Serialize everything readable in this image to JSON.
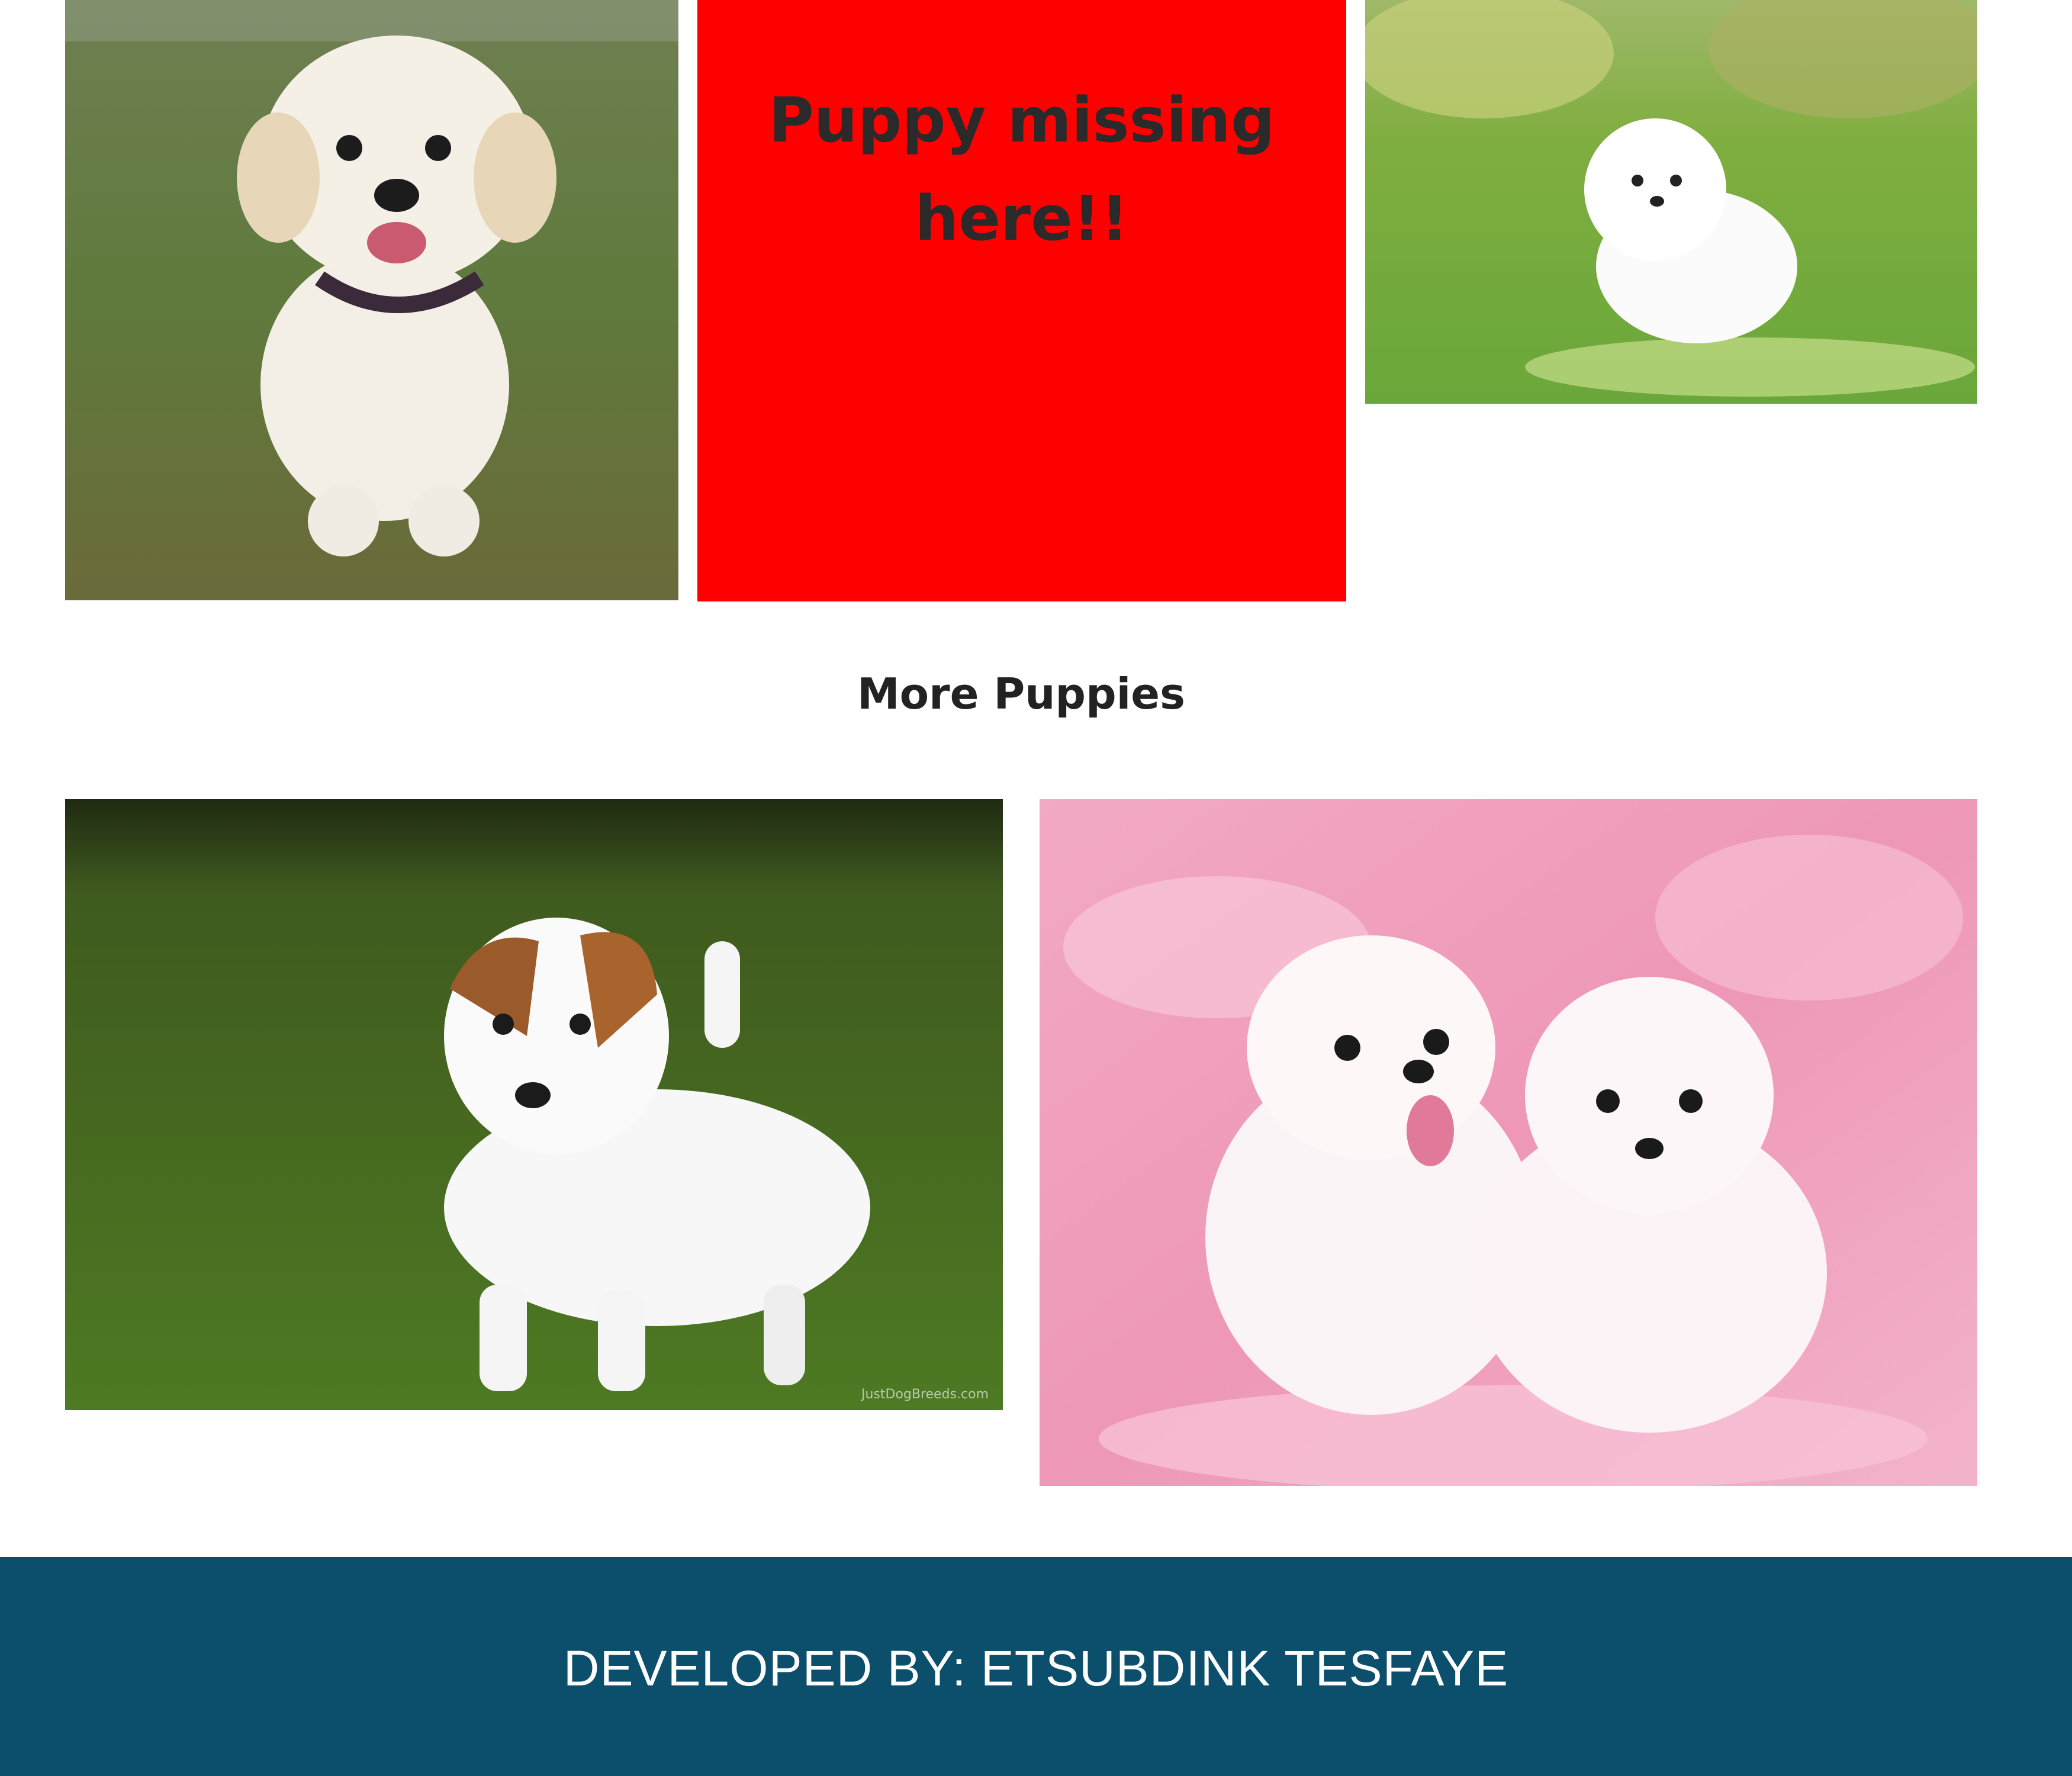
{
  "gallery": {
    "top_row": [
      {
        "subject": "cream fluffy puppy on grass",
        "icon": "puppy-photo"
      },
      {
        "missing_text_line1": "Puppy missing",
        "missing_text_line2": "here!!",
        "color": "#ff0000"
      },
      {
        "subject": "white pomeranian puppy on grass",
        "icon": "puppy-photo"
      }
    ],
    "section_heading": "More Puppies",
    "bottom_row": [
      {
        "subject": "jack russell puppy on grass",
        "watermark": "JustDogBreeds.com",
        "icon": "puppy-photo"
      },
      {
        "subject": "two white maltese puppies on pink fur",
        "icon": "puppy-photo"
      }
    ]
  },
  "footer": {
    "text": "DEVELOPED BY: ETSUBDINK TESFAYE",
    "background": "#0b4f6c"
  }
}
